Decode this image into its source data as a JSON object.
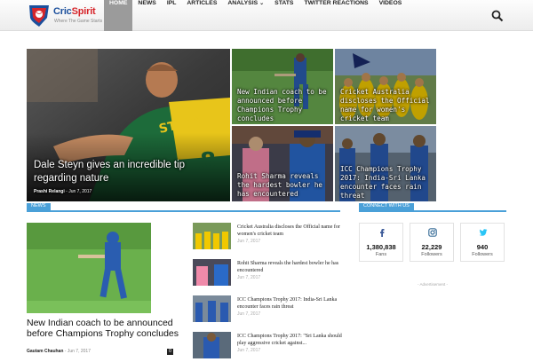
{
  "logo": {
    "name_1": "Cric",
    "name_2": "Spirit",
    "tagline": "Where The Game Starts"
  },
  "nav": [
    {
      "label": "Home",
      "active": true
    },
    {
      "label": "News"
    },
    {
      "label": "IPL"
    },
    {
      "label": "Articles"
    },
    {
      "label": "Analysis",
      "dropdown": true
    },
    {
      "label": "Stats"
    },
    {
      "label": "Twitter Reactions"
    },
    {
      "label": "Videos"
    }
  ],
  "hero": {
    "main": {
      "title": "Dale Steyn gives an incredible tip regarding nature",
      "author": "Prashi Relangi",
      "date": "Jun 7, 2017"
    },
    "tiles": [
      {
        "title": "New Indian coach to be announced before Champions Trophy concludes"
      },
      {
        "title": "Cricket Australia discloses the Official name for women's cricket team"
      },
      {
        "title": "Rohit Sharma reveals the hardest bowler he has encountered"
      },
      {
        "title": "ICC Champions Trophy 2017: India-Sri Lanka encounter faces rain threat"
      }
    ]
  },
  "news": {
    "section_label": "News",
    "featured": {
      "title": "New Indian coach to be announced before Champions Trophy concludes",
      "author": "Gautam Chauhan",
      "date": "Jun 7, 2017",
      "comments": "0"
    },
    "list": [
      {
        "title": "Cricket Australia discloses the Official name for women's cricket team",
        "date": "Jun 7, 2017"
      },
      {
        "title": "Rohit Sharma reveals the hardest bowler he has encountered",
        "date": "Jun 7, 2017"
      },
      {
        "title": "ICC Champions Trophy 2017: India-Sri Lanka encounter faces rain threat",
        "date": "Jun 7, 2017"
      },
      {
        "title": "ICC Champions Trophy 2017: \"Sri Lanka should play aggressive cricket against...",
        "date": "Jun 7, 2017"
      }
    ]
  },
  "connect": {
    "section_label": "Connect with us",
    "socials": [
      {
        "icon": "facebook-icon",
        "count": "1,380,838",
        "label": "Fans",
        "color": "#3b5998"
      },
      {
        "icon": "instagram-icon",
        "count": "22,229",
        "label": "Followers",
        "color": "#3f729b"
      },
      {
        "icon": "twitter-icon",
        "count": "940",
        "label": "Followers",
        "color": "#29c5f6"
      }
    ],
    "advertisement": "- Advertisement -"
  },
  "colors": {
    "accent": "#4aa0d8",
    "nav_active": "#9b9b9b"
  }
}
